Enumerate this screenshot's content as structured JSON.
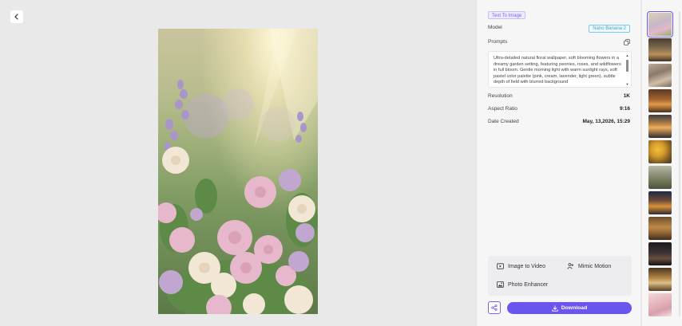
{
  "header": {
    "back_icon": "chevron-left-icon"
  },
  "preview": {
    "image_subject": "floral wallpaper"
  },
  "details": {
    "tag": "Text To Image",
    "model_label": "Model",
    "model_value": "Nano Banana 2",
    "prompts_label": "Prompts",
    "copy_icon": "copy-icon",
    "prompt_text": "Ultra-detailed natural floral wallpaper, soft blooming flowers in a dreamy garden setting, featuring peonies, roses, and wildflowers in full bloom. Gentle morning light with warm sunlight rays, soft pastel color palette (pink, cream, lavender, light green), subtle depth of field with blurred background",
    "resolution_label": "Resolution",
    "resolution_value": "1K",
    "aspect_label": "Aspect Ratio",
    "aspect_value": "9:16",
    "date_label": "Date Created",
    "date_value": "May, 13,2026, 15:29"
  },
  "tools": {
    "image_to_video": "Image to Video",
    "mimic_motion": "Mimic Motion",
    "photo_enhancer": "Photo Enhancer"
  },
  "actions": {
    "share_icon": "share-icon",
    "download_label": "Download",
    "accent_color": "#6a55ee"
  },
  "thumbnails": [
    {
      "name": "floral-garden",
      "selected": true
    },
    {
      "name": "mountain-landscape"
    },
    {
      "name": "painted-scene"
    },
    {
      "name": "autumn-street"
    },
    {
      "name": "sunset-coast"
    },
    {
      "name": "sunflowers"
    },
    {
      "name": "forest-path"
    },
    {
      "name": "festive-city"
    },
    {
      "name": "warm-village"
    },
    {
      "name": "dark-portrait"
    },
    {
      "name": "golden-figure"
    },
    {
      "name": "pink-sketch"
    }
  ]
}
